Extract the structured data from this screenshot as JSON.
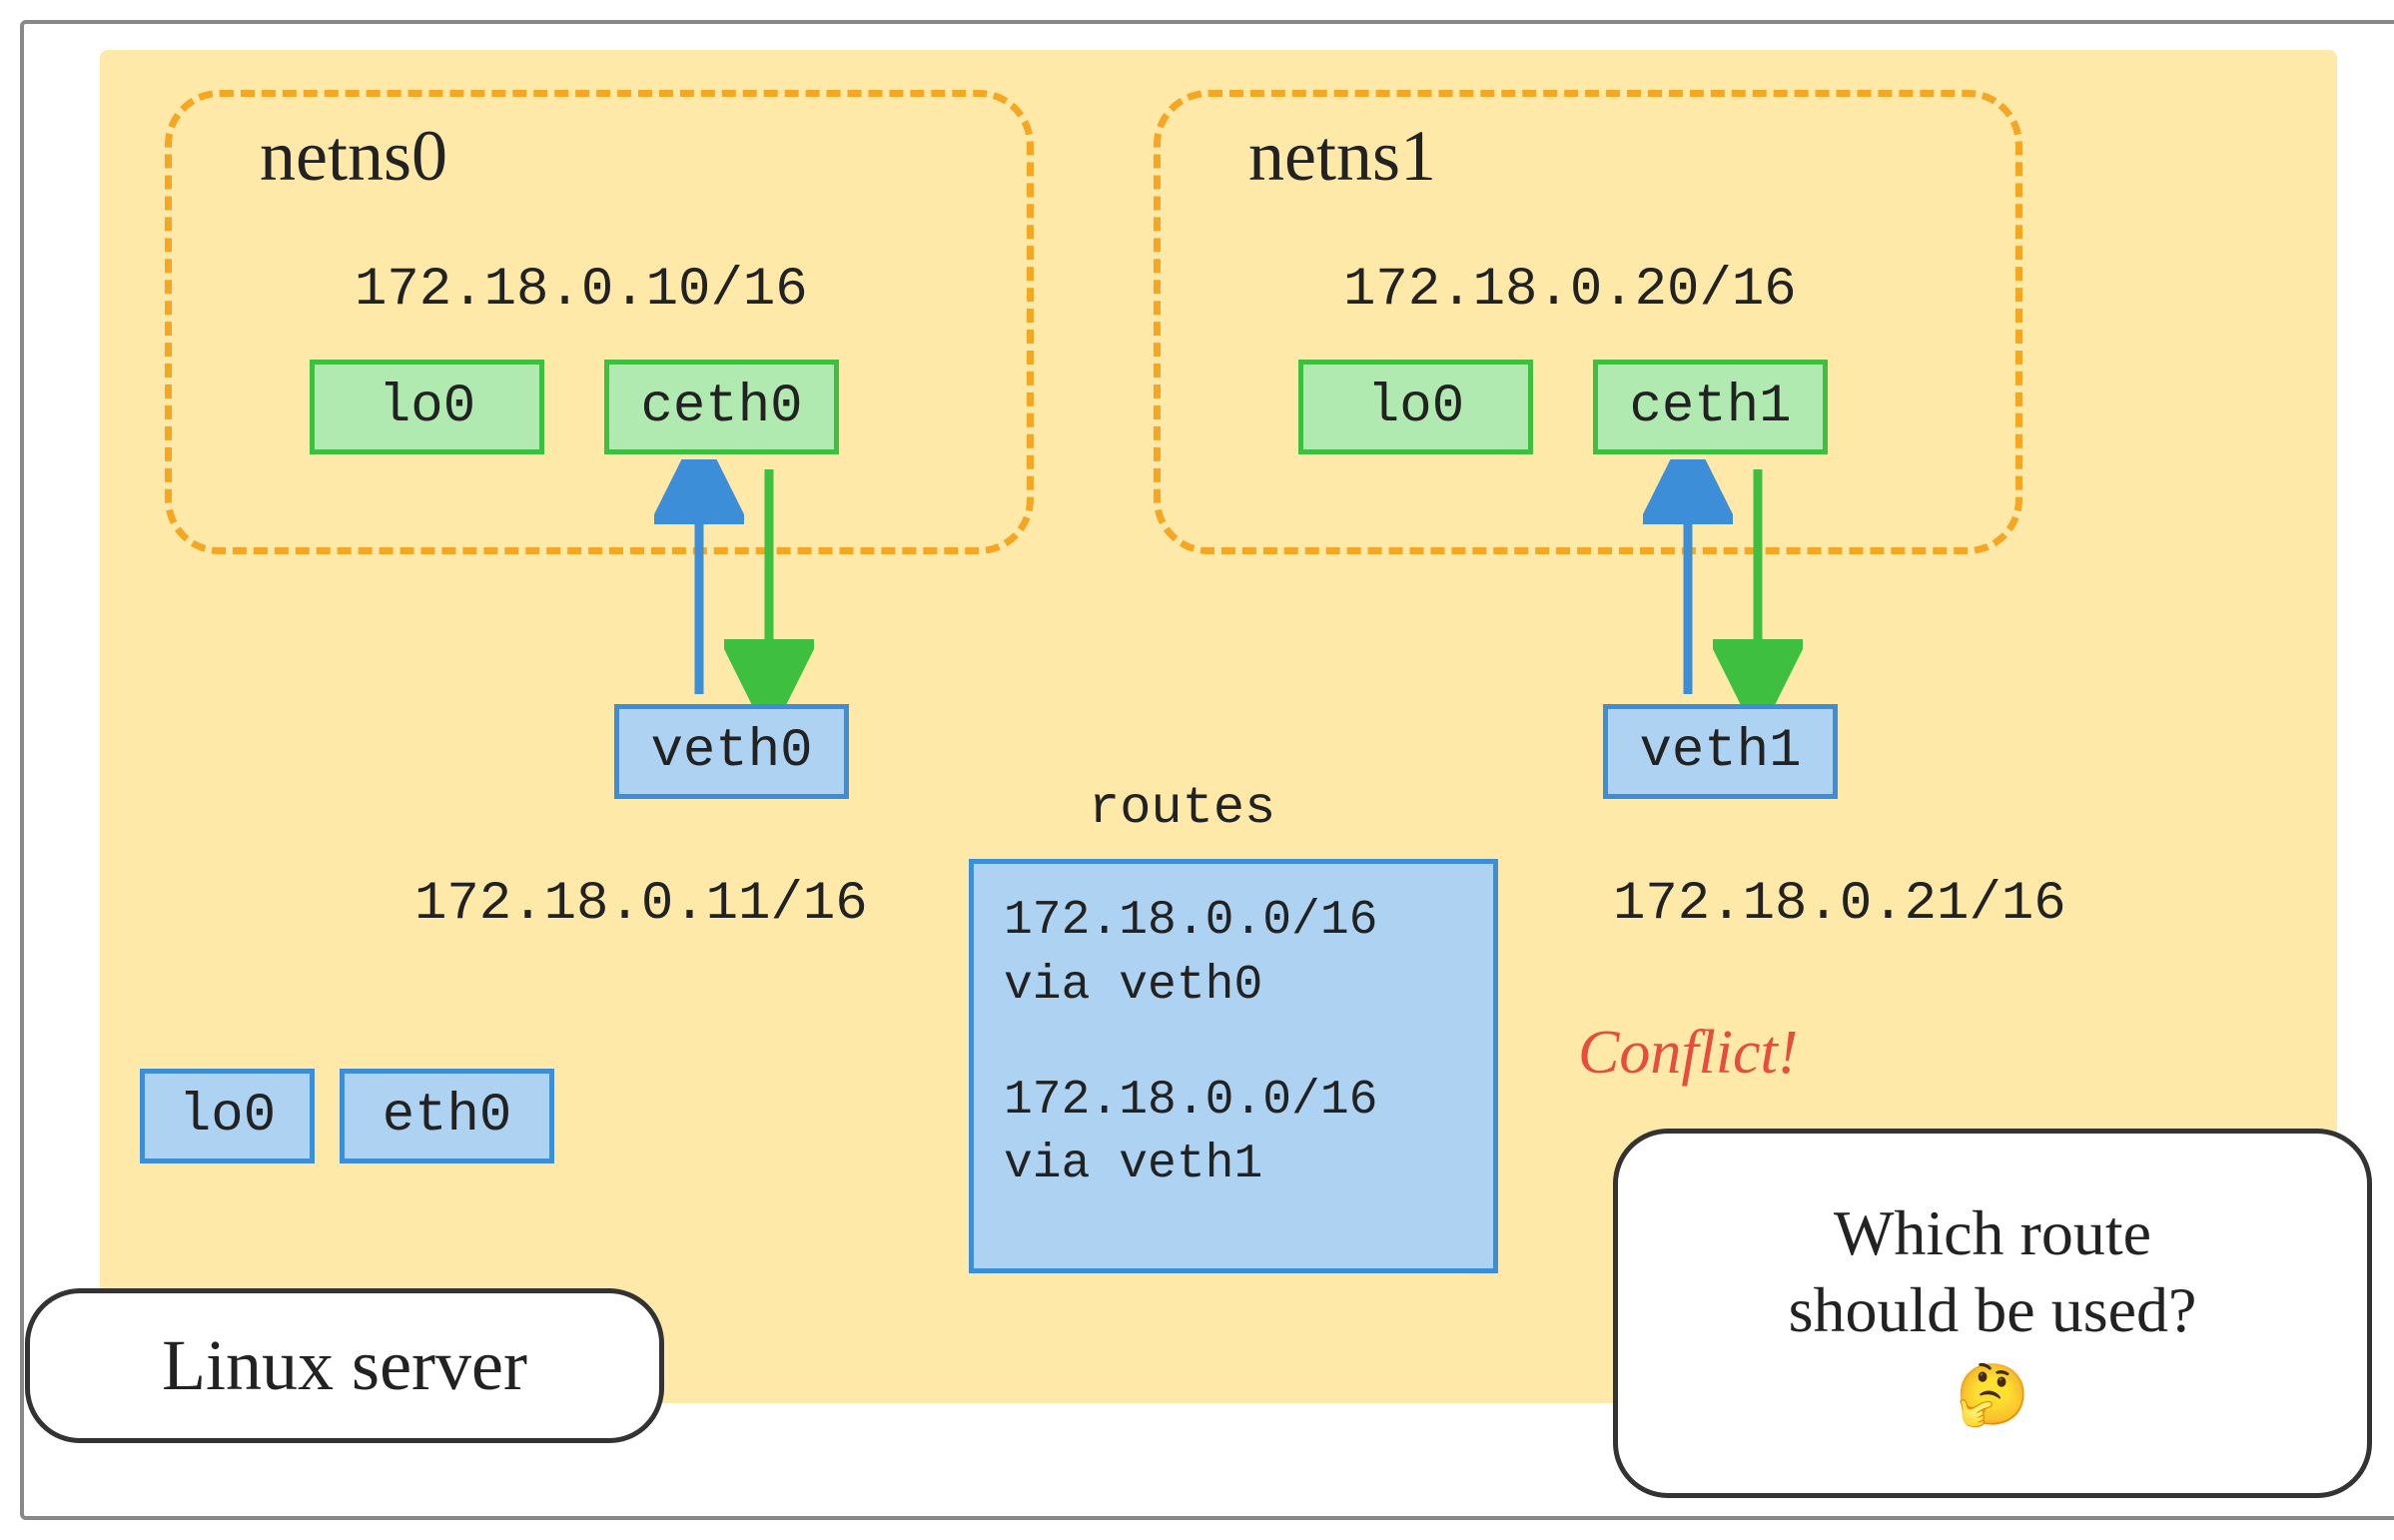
{
  "host": {
    "label": "Linux server",
    "interfaces": {
      "lo0": "lo0",
      "eth0": "eth0",
      "veth0": {
        "name": "veth0",
        "ip": "172.18.0.11/16"
      },
      "veth1": {
        "name": "veth1",
        "ip": "172.18.0.21/16"
      }
    },
    "routes": {
      "title": "routes",
      "entry1_cidr": "172.18.0.0/16",
      "entry1_via": "via veth0",
      "entry2_cidr": "172.18.0.0/16",
      "entry2_via": "via veth1"
    }
  },
  "netns0": {
    "label": "netns0",
    "lo": "lo0",
    "ceth": {
      "name": "ceth0",
      "ip": "172.18.0.10/16"
    }
  },
  "netns1": {
    "label": "netns1",
    "lo": "lo0",
    "ceth": {
      "name": "ceth1",
      "ip": "172.18.0.20/16"
    }
  },
  "annotations": {
    "conflict": "Conflict!",
    "question_line1": "Which route",
    "question_line2": "should be used?",
    "emoji": "🤔"
  },
  "colors": {
    "host_bg": "#ffe9a8",
    "netns_border": "#f5a623",
    "green_fill": "#b0eab0",
    "green_border": "#3fbf3f",
    "blue_fill": "#aed3f2",
    "blue_border": "#3d8ed8",
    "conflict_text": "#e74c3c"
  }
}
